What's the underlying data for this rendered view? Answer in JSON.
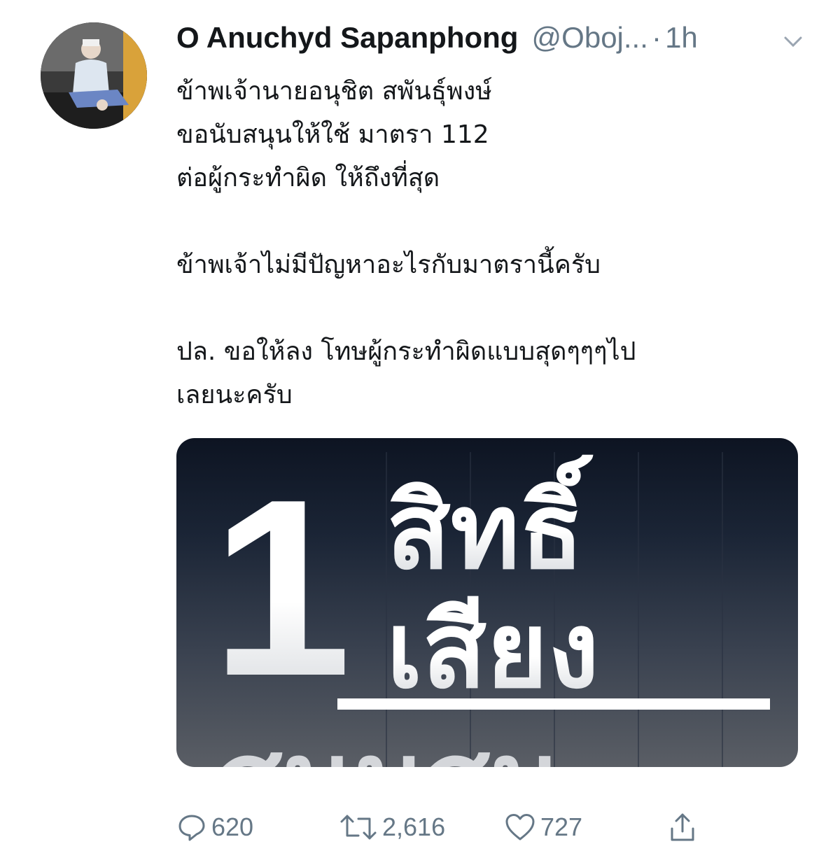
{
  "tweet": {
    "author_name": "O Anuchyd Sapanphong",
    "handle": "@Oboj...",
    "separator": "·",
    "time": "1h",
    "lines": [
      "ข้าพเจ้านายอนุชิต สพันธุ์พงษ์",
      "ขอนับสนุนให้ใช้ มาตรา 112",
      "ต่อผู้กระทำผิด ให้ถึงที่สุด",
      "",
      "ข้าพเจ้าไม่มีปัญหาอะไรกับมาตรานี้ครับ",
      "",
      "ปล. ขอให้ลง โทษผู้กระทำผิดแบบสุดๆๆๆไป",
      "เลยนะครับ"
    ]
  },
  "card": {
    "big_number": "1",
    "line1": "สิทธิ์",
    "line2": "เสียง",
    "line3": "สนนสน"
  },
  "actions": {
    "reply_icon": "reply-icon",
    "reply_count": "620",
    "retweet_icon": "retweet-icon",
    "retweet_count": "2,616",
    "like_icon": "heart-icon",
    "like_count": "727",
    "share_icon": "share-icon"
  },
  "colors": {
    "text": "#14171a",
    "muted": "#657786",
    "card_dark": "#0d1422"
  }
}
